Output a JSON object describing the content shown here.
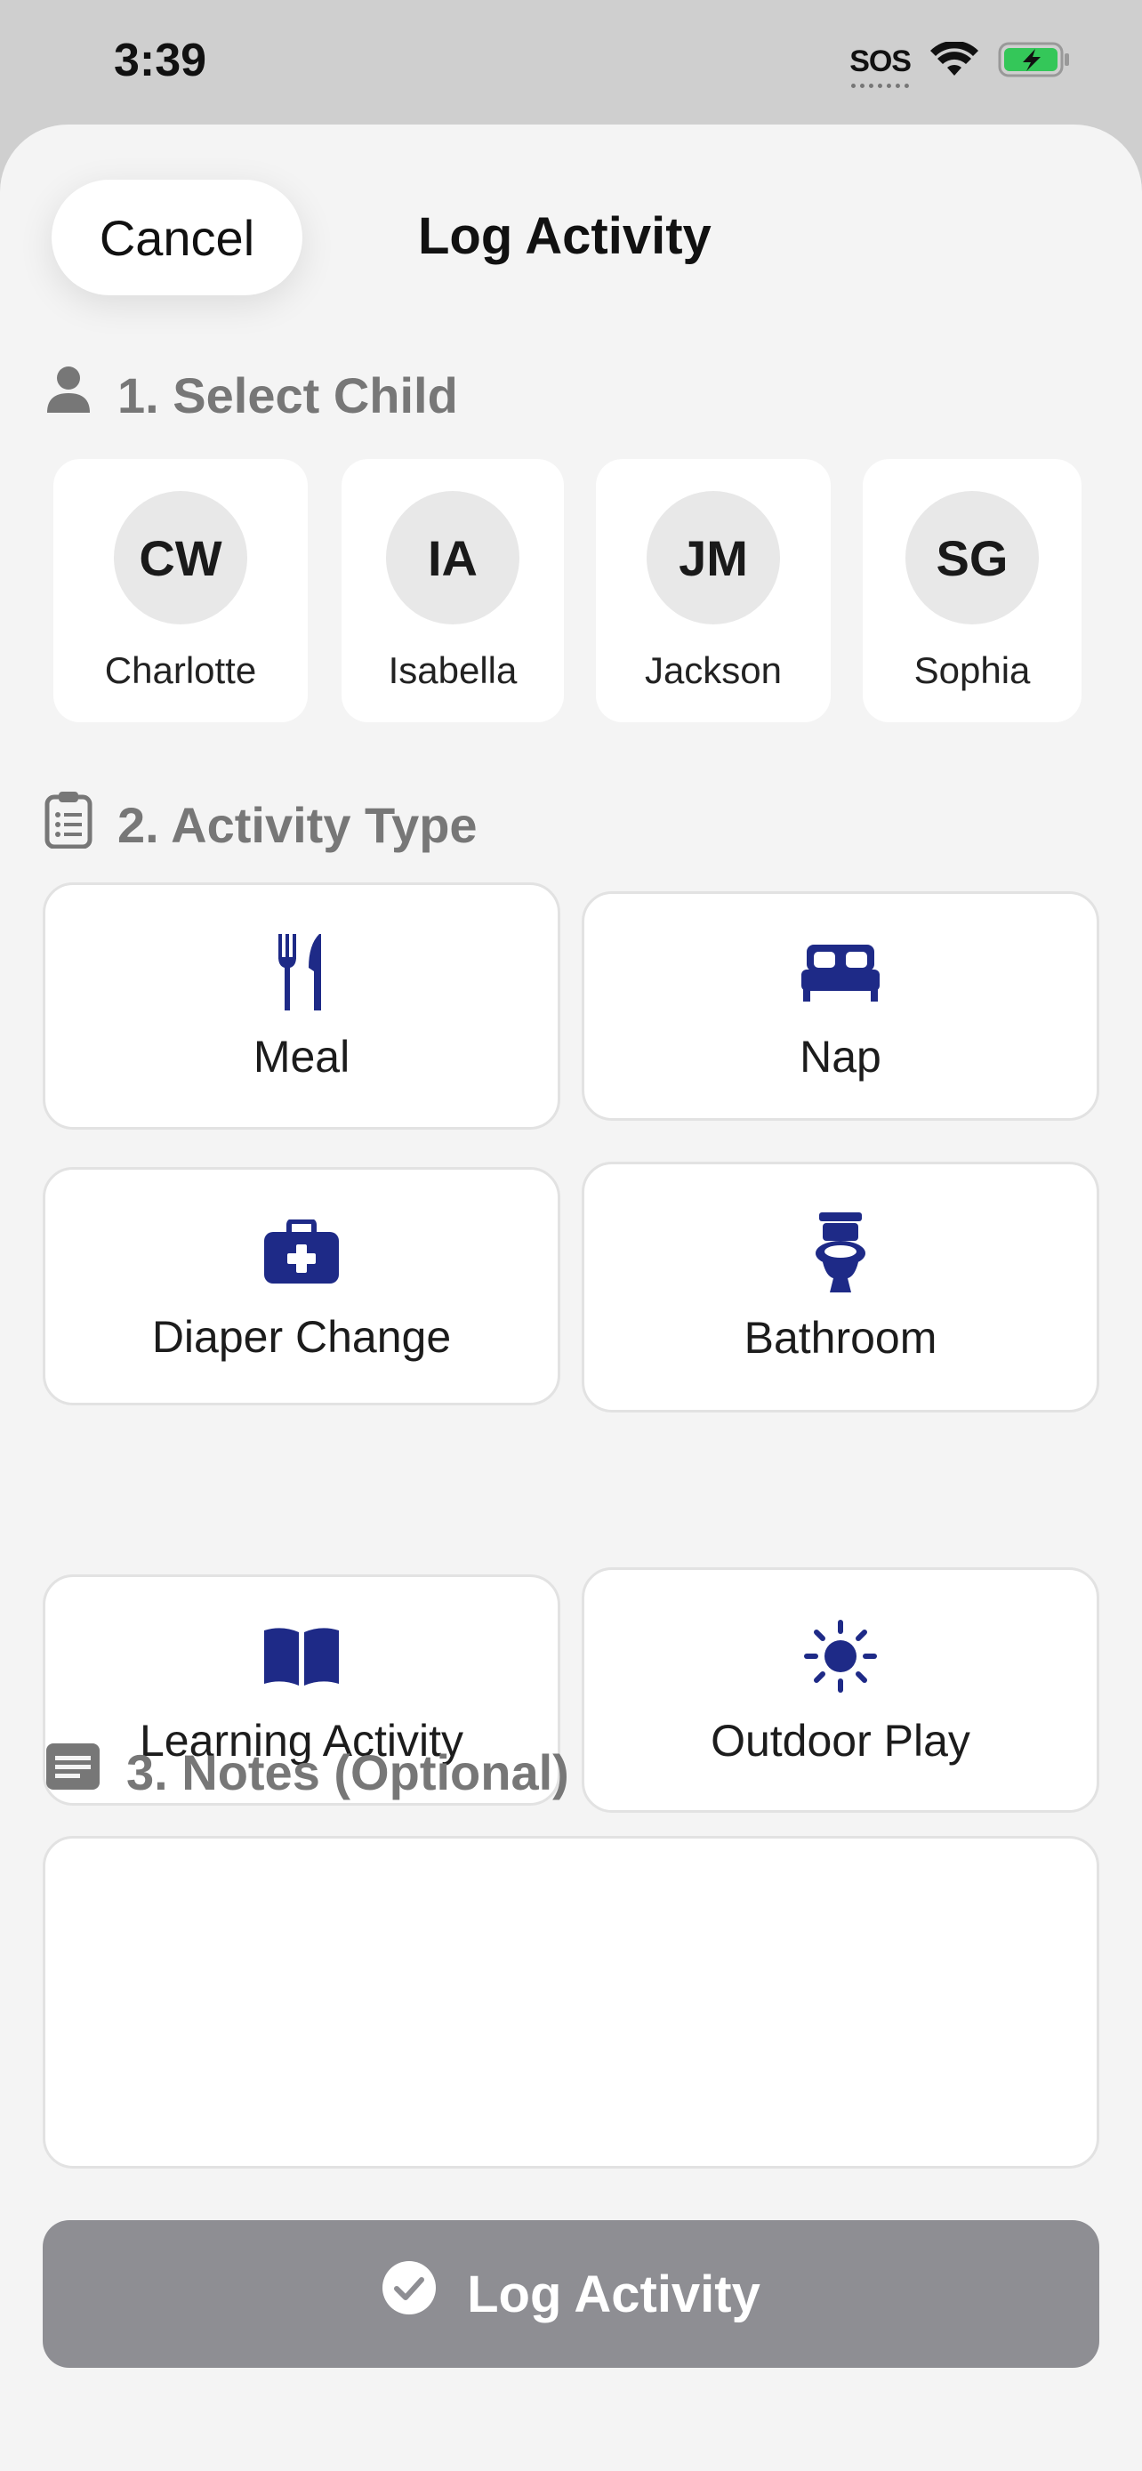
{
  "status_bar": {
    "time": "3:39",
    "sos": "SOS"
  },
  "header": {
    "cancel_label": "Cancel",
    "title": "Log Activity"
  },
  "sections": {
    "select_child": "1. Select Child",
    "activity_type": "2. Activity Type",
    "notes": "3. Notes (Optional)"
  },
  "children": [
    {
      "initials": "CW",
      "name": "Charlotte"
    },
    {
      "initials": "IA",
      "name": "Isabella"
    },
    {
      "initials": "JM",
      "name": "Jackson"
    },
    {
      "initials": "SG",
      "name": "Sophia"
    }
  ],
  "activities": [
    {
      "label": "Meal",
      "icon": "utensils-icon"
    },
    {
      "label": "Nap",
      "icon": "bed-icon"
    },
    {
      "label": "Diaper Change",
      "icon": "medical-kit-icon"
    },
    {
      "label": "Bathroom",
      "icon": "toilet-icon"
    },
    {
      "label": "Learning Activity",
      "icon": "book-icon"
    },
    {
      "label": "Outdoor Play",
      "icon": "sun-icon"
    }
  ],
  "notes": {
    "value": ""
  },
  "submit": {
    "label": "Log Activity",
    "icon": "check-circle-icon"
  },
  "colors": {
    "accent": "#1e2a87",
    "disabled_button": "#8e8e93",
    "section_text": "#777777"
  }
}
